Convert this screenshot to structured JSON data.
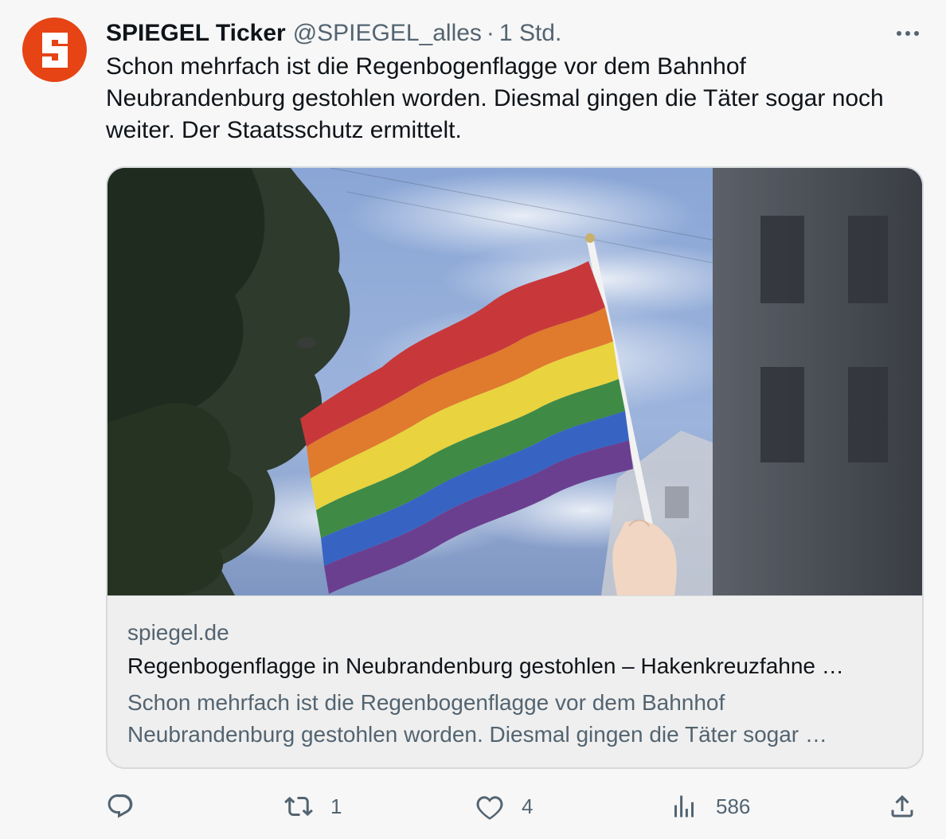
{
  "author": {
    "name": "SPIEGEL Ticker",
    "handle": "@SPIEGEL_alles",
    "separator": "·",
    "time": "1 Std.",
    "avatar_letter": "S",
    "avatar_color": "#e64415"
  },
  "tweet": {
    "text": "Schon mehrfach ist die Regenbogenflagge vor dem Bahnhof Neubrandenburg gestohlen worden. Diesmal gingen die Täter sogar noch weiter. Der Staatsschutz ermittelt."
  },
  "card": {
    "image": "rainbow-flag-photo",
    "domain": "spiegel.de",
    "title": "Regenbogenflagge in Neubrandenburg gestohlen – Hakenkreuzfahne …",
    "description": "Schon mehrfach ist die Regenbogenflagge vor dem Bahnhof Neubrandenburg gestohlen worden. Diesmal gingen die Täter sogar …"
  },
  "actions": {
    "reply": {
      "icon": "reply-icon",
      "count": ""
    },
    "retweet": {
      "icon": "retweet-icon",
      "count": "1"
    },
    "like": {
      "icon": "heart-icon",
      "count": "4"
    },
    "views": {
      "icon": "views-icon",
      "count": "586"
    },
    "share": {
      "icon": "share-icon"
    }
  },
  "colors": {
    "text": "#0f1419",
    "secondary": "#536471",
    "brand": "#e64415"
  }
}
